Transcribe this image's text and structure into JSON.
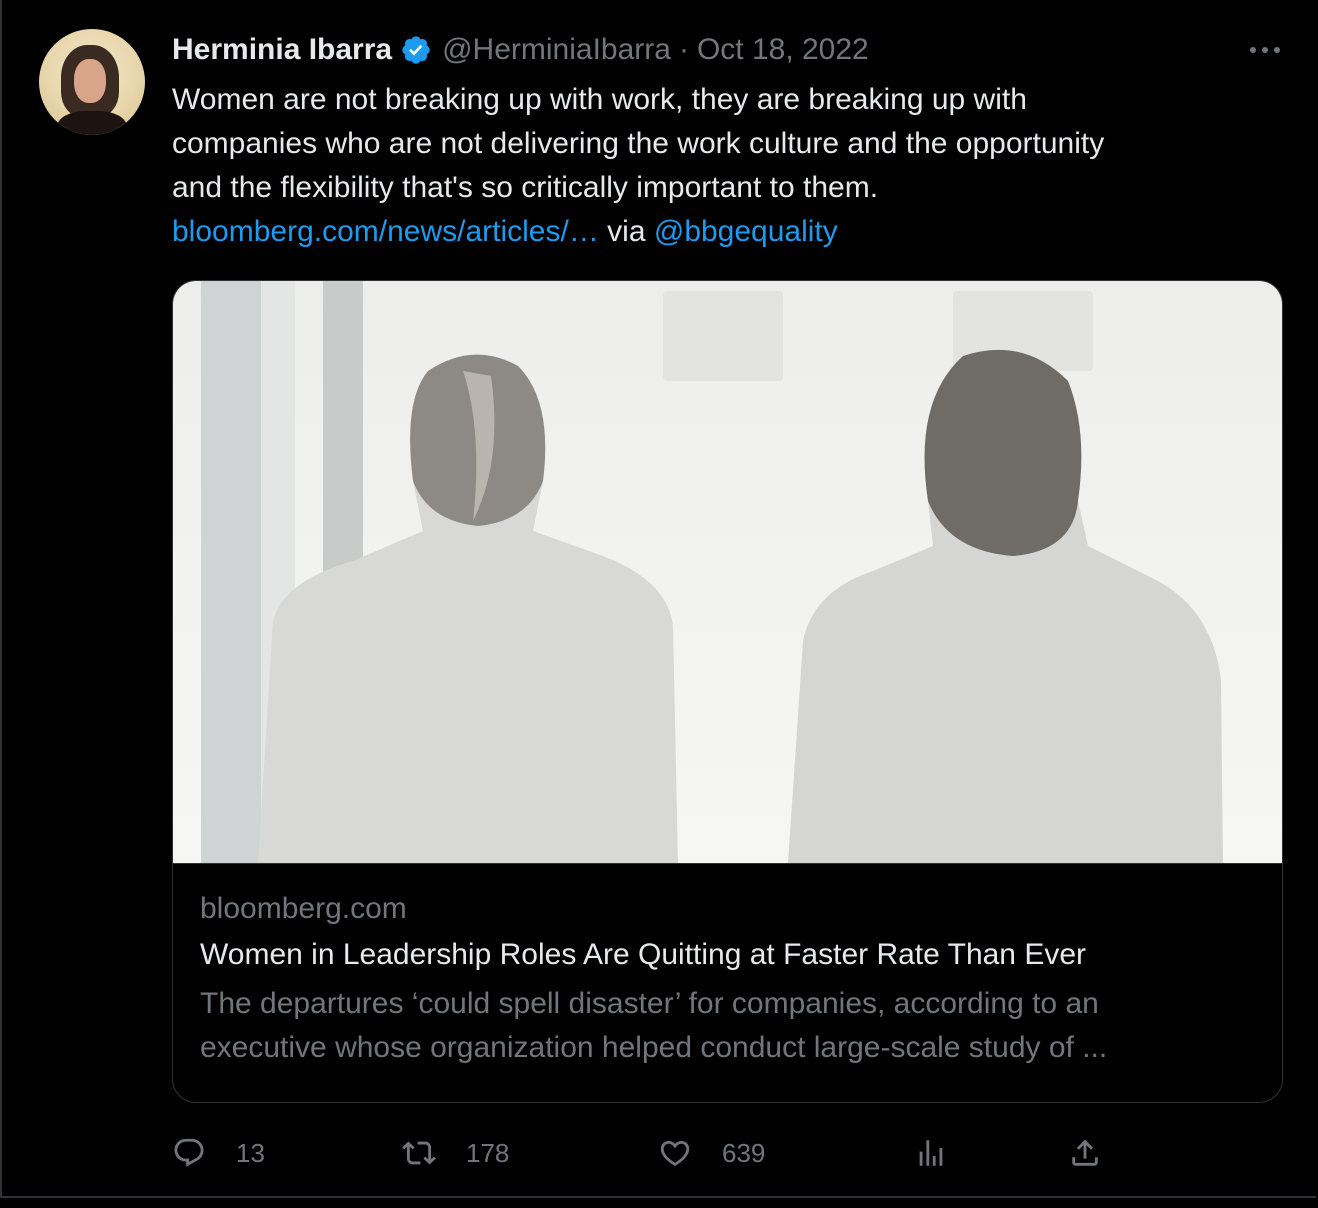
{
  "author": {
    "display_name": "Herminia Ibarra",
    "handle": "@HerminiaIbarra",
    "separator": "·",
    "date": "Oct 18, 2022",
    "verified": true
  },
  "tweet": {
    "text_lines": [
      "Women are not breaking up with work, they are breaking up with",
      "companies who are not delivering the work culture and the opportunity",
      "and the flexibility that's so critically important to them."
    ],
    "link_text": "bloomberg.com/news/articles/…",
    "via_text": " via ",
    "mention": "@bbgequality"
  },
  "card": {
    "domain": "bloomberg.com",
    "title": "Women in Leadership Roles Are Quitting at Faster Rate Than Ever",
    "description_lines": [
      "The departures ‘could spell disaster’ for companies, according to an",
      "executive whose organization helped conduct large-scale study of ..."
    ]
  },
  "actions": {
    "replies": "13",
    "retweets": "178",
    "likes": "639"
  },
  "colors": {
    "background": "#000000",
    "text": "#e7e9ea",
    "secondary": "#71767b",
    "link": "#1d9bf0",
    "border": "#2f3336"
  },
  "icons": [
    "more-icon",
    "verified-icon",
    "reply-icon",
    "retweet-icon",
    "like-icon",
    "views-icon",
    "share-icon"
  ]
}
